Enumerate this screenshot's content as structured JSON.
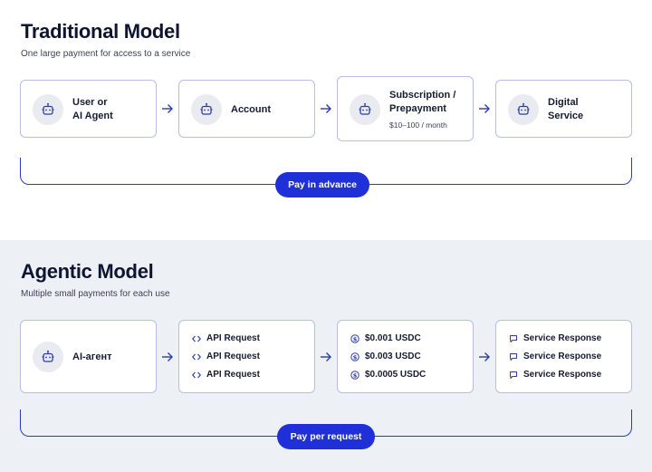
{
  "traditional": {
    "title": "Traditional Model",
    "subtitle": "One large payment for access to a service",
    "steps": [
      {
        "line1": "User or",
        "line2": "AI Agent",
        "icon": "robot-icon"
      },
      {
        "line1": "Account",
        "icon": "robot-icon"
      },
      {
        "line1": "Subscription /",
        "line2": "Prepayment",
        "note": "$10–100 / month",
        "icon": "robot-icon"
      },
      {
        "line1": "Digital",
        "line2": "Service",
        "icon": "robot-icon"
      }
    ],
    "pill": "Pay in advance"
  },
  "agentic": {
    "title": "Agentic Model",
    "subtitle": "Multiple small payments for each use",
    "agent": {
      "label": "AI-агент",
      "icon": "robot-icon"
    },
    "requests": [
      "API Request",
      "API Request",
      "API Request"
    ],
    "payments": [
      "$0.001 USDC",
      "$0.003 USDC",
      "$0.0005 USDC"
    ],
    "responses": [
      "Service Response",
      "Service Response",
      "Service Response"
    ],
    "pill": "Pay per request"
  },
  "colors": {
    "accent": "#1f30d8",
    "card_border": "#b7bde6",
    "bottom_background": "#edf0f5",
    "icon_stroke": "#2c3ea8"
  }
}
